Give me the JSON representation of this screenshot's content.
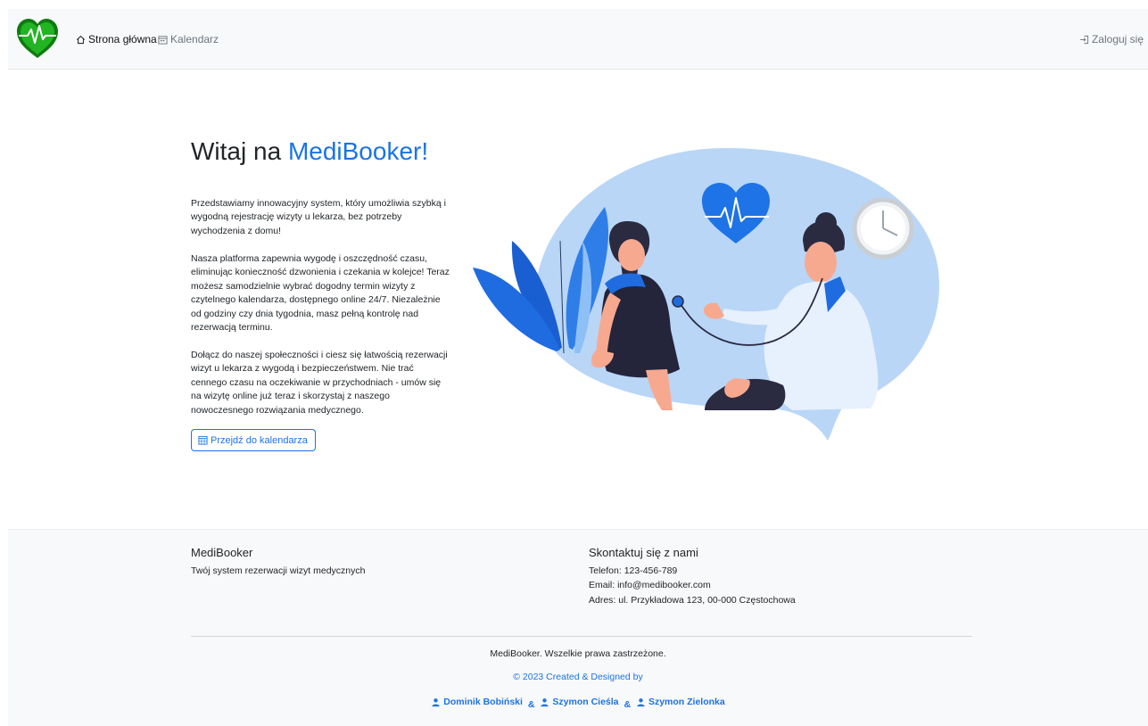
{
  "nav": {
    "home_label": "Strona główna",
    "calendar_label": "Kalendarz",
    "login_label": "Zaloguj się"
  },
  "hero": {
    "title_prefix": "Witaj na",
    "title_brand": "MediBooker!",
    "paragraphs": [
      "Przedstawiamy innowacyjny system, który umożliwia szybką i wygodną rejestrację wizyty u lekarza, bez potrzeby wychodzenia z domu!",
      "Nasza platforma zapewnia wygodę i oszczędność czasu, eliminując konieczność dzwonienia i czekania w kolejce! Teraz możesz samodzielnie wybrać dogodny termin wizyty z czytelnego kalendarza, dostępnego online 24/7. Niezależnie od godziny czy dnia tygodnia, masz pełną kontrolę nad rezerwacją terminu.",
      "Dołącz do naszej społeczności i ciesz się łatwością rezerwacji wizyt u lekarza z wygodą i bezpieczeństwem. Nie trać cennego czasu na oczekiwanie w przychodniach - umów się na wizytę online już teraz i skorzystaj z naszego nowoczesnego rozwiązania medycznego."
    ],
    "cta_label": "Przejdź do kalendarza"
  },
  "footer": {
    "brand": "MediBooker",
    "tagline": "Twój system rezerwacji wizyt medycznych",
    "contact_heading": "Skontaktuj się z nami",
    "phone": "Telefon: 123-456-789",
    "email": "Email: info@medibooker.com",
    "address": "Adres: ul. Przykładowa 123, 00-000 Częstochowa",
    "rights": "MediBooker. Wszelkie prawa zastrzeżone.",
    "copyright": "© 2023 Created & Designed by",
    "authors": [
      "Dominik Bobiński",
      "Szymon Cieśla",
      "Szymon Zielonka"
    ],
    "author_separator": "&"
  },
  "colors": {
    "accent": "#1a73e8",
    "brand_green": "#1fa31f",
    "illustration_blue": "#b9d6f7",
    "navbar_bg": "#f8f9fa"
  },
  "icons": {
    "logo": "heart-pulse-logo-icon",
    "home": "house-icon",
    "calendar": "calendar-icon",
    "login": "login-icon",
    "cta": "calendar-grid-icon",
    "author": "person-icon"
  }
}
